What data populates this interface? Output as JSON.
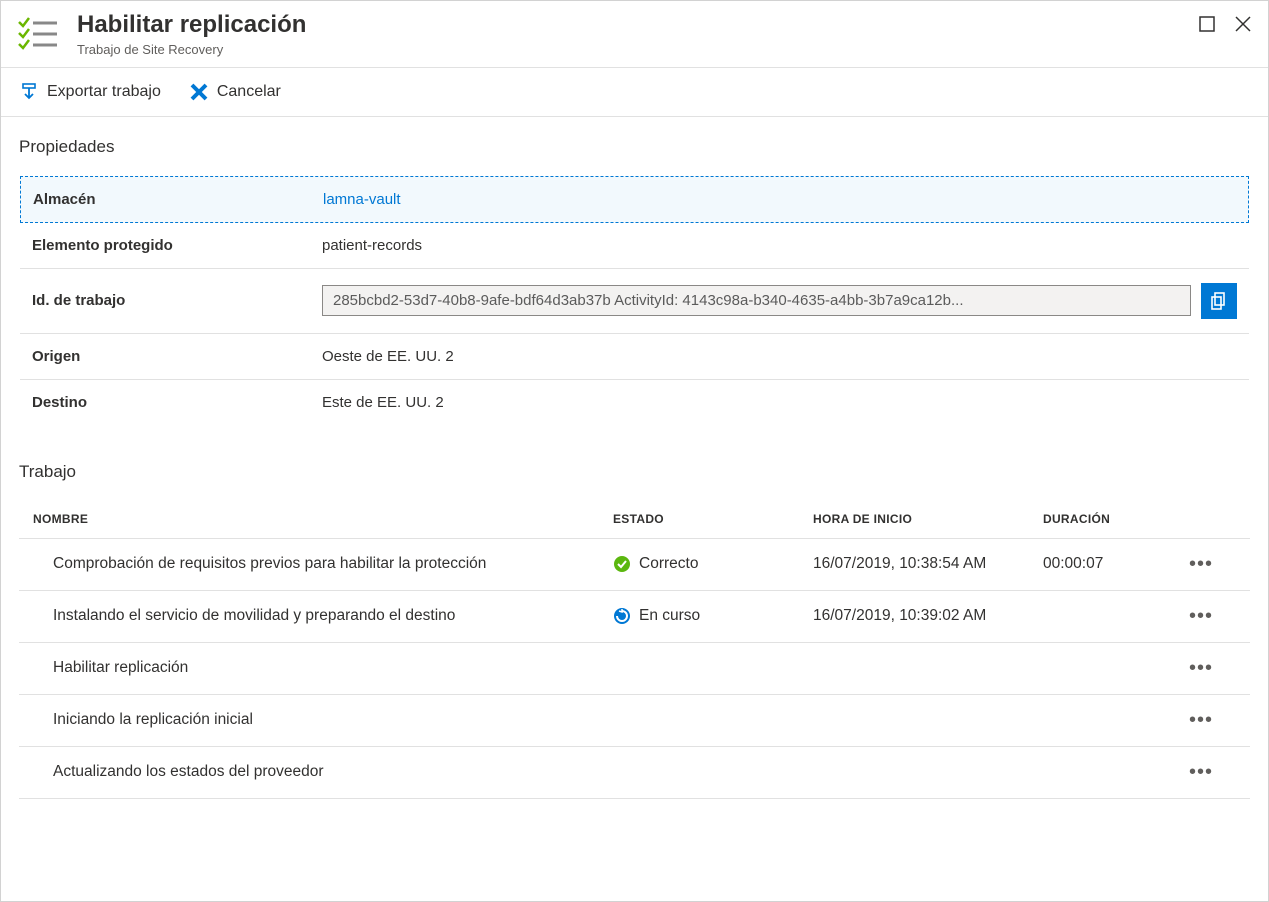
{
  "header": {
    "title": "Habilitar replicación",
    "subtitle": "Trabajo de Site Recovery"
  },
  "toolbar": {
    "export_label": "Exportar trabajo",
    "cancel_label": "Cancelar"
  },
  "sections": {
    "properties_title": "Propiedades",
    "jobs_title": "Trabajo"
  },
  "properties": {
    "vault_label": "Almacén",
    "vault_value": "lamna-vault",
    "protected_item_label": "Elemento protegido",
    "protected_item_value": "patient-records",
    "job_id_label": "Id. de trabajo",
    "job_id_value": "285bcbd2-53d7-40b8-9afe-bdf64d3ab37b ActivityId: 4143c98a-b340-4635-a4bb-3b7a9ca12b...",
    "origin_label": "Origen",
    "origin_value": "Oeste de EE. UU. 2",
    "destination_label": "Destino",
    "destination_value": "Este de EE. UU. 2"
  },
  "jobs_columns": {
    "name": "NOMBRE",
    "state": "ESTADO",
    "start": "HORA DE INICIO",
    "duration": "DURACIÓN"
  },
  "jobs": [
    {
      "name": "Comprobación de requisitos previos para habilitar la protección",
      "state_icon": "success",
      "state_text": "Correcto",
      "start": "16/07/2019, 10:38:54 AM",
      "duration": "00:00:07"
    },
    {
      "name": "Instalando el servicio de movilidad y preparando el destino",
      "state_icon": "progress",
      "state_text": "En curso",
      "start": "16/07/2019, 10:39:02 AM",
      "duration": ""
    },
    {
      "name": "Habilitar replicación",
      "state_icon": "",
      "state_text": "",
      "start": "",
      "duration": ""
    },
    {
      "name": "Iniciando la replicación inicial",
      "state_icon": "",
      "state_text": "",
      "start": "",
      "duration": ""
    },
    {
      "name": "Actualizando los estados del proveedor",
      "state_icon": "",
      "state_text": "",
      "start": "",
      "duration": ""
    }
  ]
}
